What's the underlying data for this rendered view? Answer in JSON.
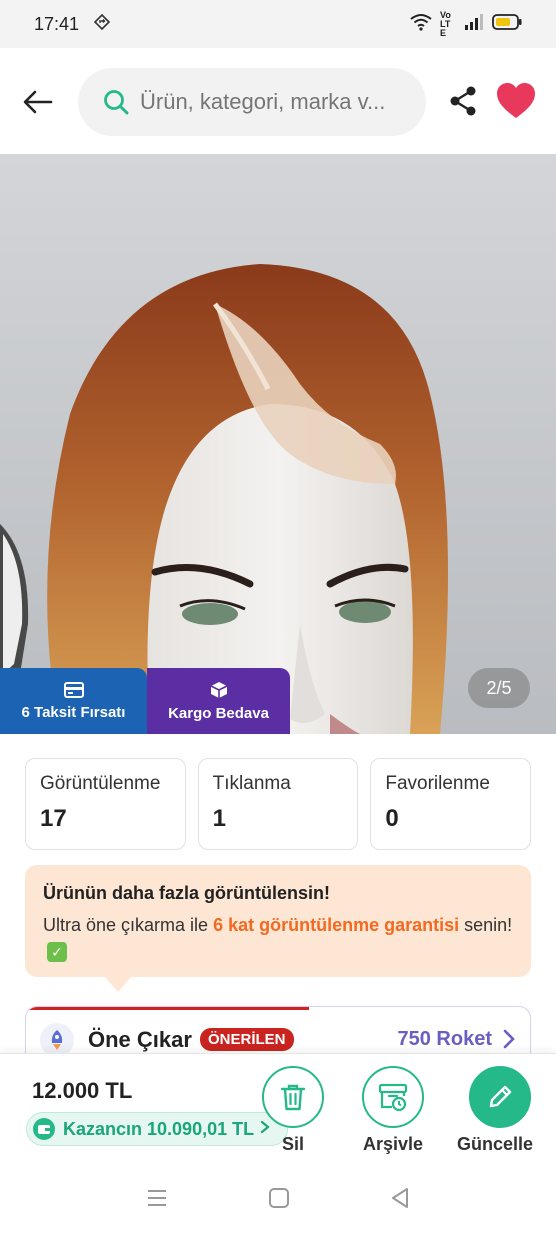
{
  "status_bar": {
    "time": "17:41",
    "network_label": "Vo LTE"
  },
  "header": {
    "search_placeholder": "Ürün, kategori, marka v...",
    "icons": [
      "back-arrow-icon",
      "search-icon",
      "share-icon",
      "heart-icon"
    ]
  },
  "gallery": {
    "page_counter": "2/5",
    "badges": [
      {
        "label": "6 Taksit Fırsatı",
        "icon": "card-icon",
        "color": "#1d63b3"
      },
      {
        "label": "Kargo Bedava",
        "icon": "box-icon",
        "color": "#5b2fa3"
      }
    ]
  },
  "stats": [
    {
      "label": "Görüntülenme",
      "value": "17"
    },
    {
      "label": "Tıklanma",
      "value": "1"
    },
    {
      "label": "Favorilenme",
      "value": "0"
    }
  ],
  "promo": {
    "title": "Ürünün daha fazla görüntülensin!",
    "text_before": "Ultra öne çıkarma ile ",
    "highlight": "6 kat görüntülenme garantisi",
    "text_after": " senin!",
    "highlight_color": "#f26a21"
  },
  "boost": {
    "title": "Öne Çıkar",
    "badge": "ÖNERİLEN",
    "price": "750 Roket"
  },
  "footer": {
    "price": "12.000 TL",
    "earnings": "Kazancın 10.090,01 TL",
    "actions": [
      {
        "label": "Sil",
        "icon": "trash-icon"
      },
      {
        "label": "Arşivle",
        "icon": "archive-icon"
      },
      {
        "label": "Güncelle",
        "icon": "pencil-icon"
      }
    ],
    "accent_color": "#25b98a"
  }
}
